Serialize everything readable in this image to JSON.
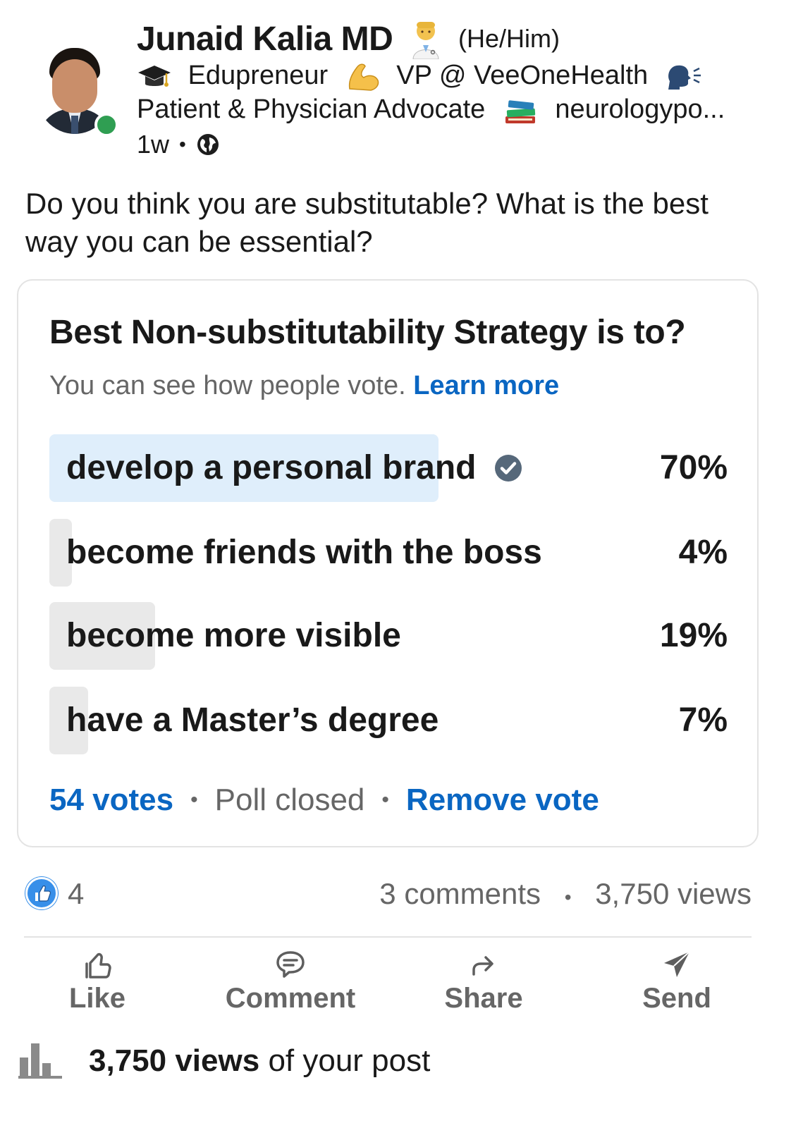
{
  "author": {
    "name": "Junaid Kalia MD",
    "pronouns": "(He/Him)",
    "headline_line1": {
      "part1": "Edupreneur",
      "part2": "VP @ VeeOneHealth"
    },
    "headline_line2": {
      "part1": "Patient & Physician Advocate",
      "part2": "neurologypo..."
    },
    "time_ago": "1w",
    "online_status_color": "#2f9e52"
  },
  "post": {
    "text": "Do you think you are substitutable? What is the best way you can be essential?"
  },
  "poll": {
    "question": "Best Non-substitutability Strategy is to?",
    "visibility_note": "You can see how people vote.",
    "learn_more": "Learn more",
    "options": [
      {
        "label": "develop a personal brand",
        "percent": "70%",
        "value": 70,
        "selected": true
      },
      {
        "label": "become friends with the boss",
        "percent": "4%",
        "value": 4,
        "selected": false
      },
      {
        "label": "become more visible",
        "percent": "19%",
        "value": 19,
        "selected": false
      },
      {
        "label": "have a Master’s degree",
        "percent": "7%",
        "value": 7,
        "selected": false
      }
    ],
    "votes": "54 votes",
    "status": "Poll closed",
    "remove_vote": "Remove vote"
  },
  "social": {
    "reactions_count": "4",
    "comments": "3 comments",
    "views": "3,750 views"
  },
  "actions": {
    "like": "Like",
    "comment": "Comment",
    "share": "Share",
    "send": "Send"
  },
  "analytics": {
    "views_bold": "3,750 views",
    "views_suffix": "of your post"
  },
  "colors": {
    "accent_blue": "#0a66c2",
    "selected_bar": "#dfeefb",
    "unselected_bar": "#e9e9e9",
    "muted_text": "#666666",
    "like_badge": "#378fe9"
  }
}
